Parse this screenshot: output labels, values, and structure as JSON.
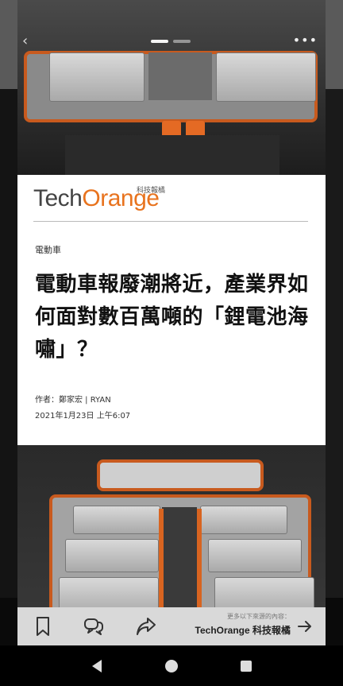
{
  "story": {
    "category": "電動車",
    "headline": "電動車報廢潮將近，產業界如何面對數百萬噸的「鋰電池海嘯」？",
    "byline": "作者：鄭家宏 | RYAN",
    "date": "2021年1月23日 上午6:07"
  },
  "logo": {
    "part1": "Tech",
    "part2": "Orange",
    "subtitle": "科技報橘"
  },
  "action_bar": {
    "more_hint": "更多以下來源的內容：",
    "source": "TechOrange 科技報橘"
  },
  "icons": {
    "back": "chevron-left-icon",
    "more": "more-dots-icon",
    "bookmark": "bookmark-icon",
    "comment": "comment-icon",
    "share": "share-icon",
    "source_arrow": "arrow-right-icon",
    "nav_back": "triangle-back-icon",
    "nav_home": "circle-home-icon",
    "nav_recents": "square-recents-icon"
  },
  "colors": {
    "brand_orange": "#e8731e",
    "logo_gray": "#444444",
    "action_bar": "#d9d9d9"
  },
  "pager": {
    "pages": 2,
    "active": 1
  }
}
